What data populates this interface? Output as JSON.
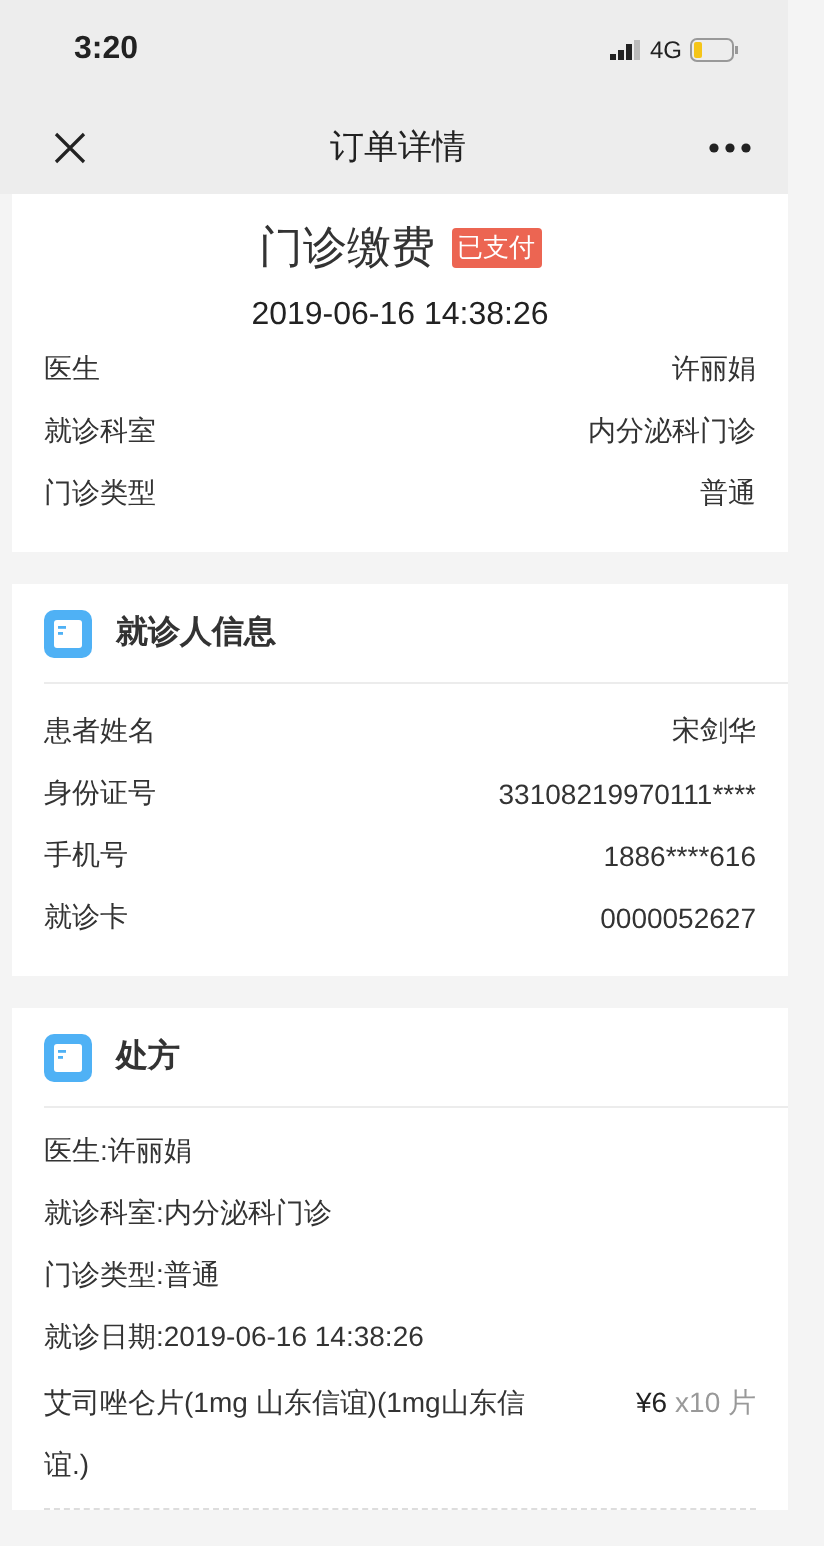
{
  "status_bar": {
    "time": "3:20",
    "network": "4G"
  },
  "nav": {
    "title": "订单详情"
  },
  "summary": {
    "title": "门诊缴费",
    "badge": "已支付",
    "datetime": "2019-06-16 14:38:26",
    "rows": [
      {
        "label": "医生",
        "value": "许丽娟"
      },
      {
        "label": "就诊科室",
        "value": "内分泌科门诊"
      },
      {
        "label": "门诊类型",
        "value": "普通"
      }
    ]
  },
  "patient": {
    "title": "就诊人信息",
    "rows": [
      {
        "label": "患者姓名",
        "value": "宋剑华"
      },
      {
        "label": "身份证号",
        "value": "33108219970111****"
      },
      {
        "label": "手机号",
        "value": "1886****616"
      },
      {
        "label": "就诊卡",
        "value": "0000052627"
      }
    ]
  },
  "prescription": {
    "title": "处方",
    "lines": [
      "医生:许丽娟",
      "就诊科室:内分泌科门诊",
      "门诊类型:普通",
      "就诊日期:2019-06-16 14:38:26"
    ],
    "drugs": [
      {
        "name": "艾司唑仑片(1mg 山东信谊)(1mg山东信谊.)",
        "price": "¥6",
        "quantity": "x10 片"
      }
    ]
  }
}
